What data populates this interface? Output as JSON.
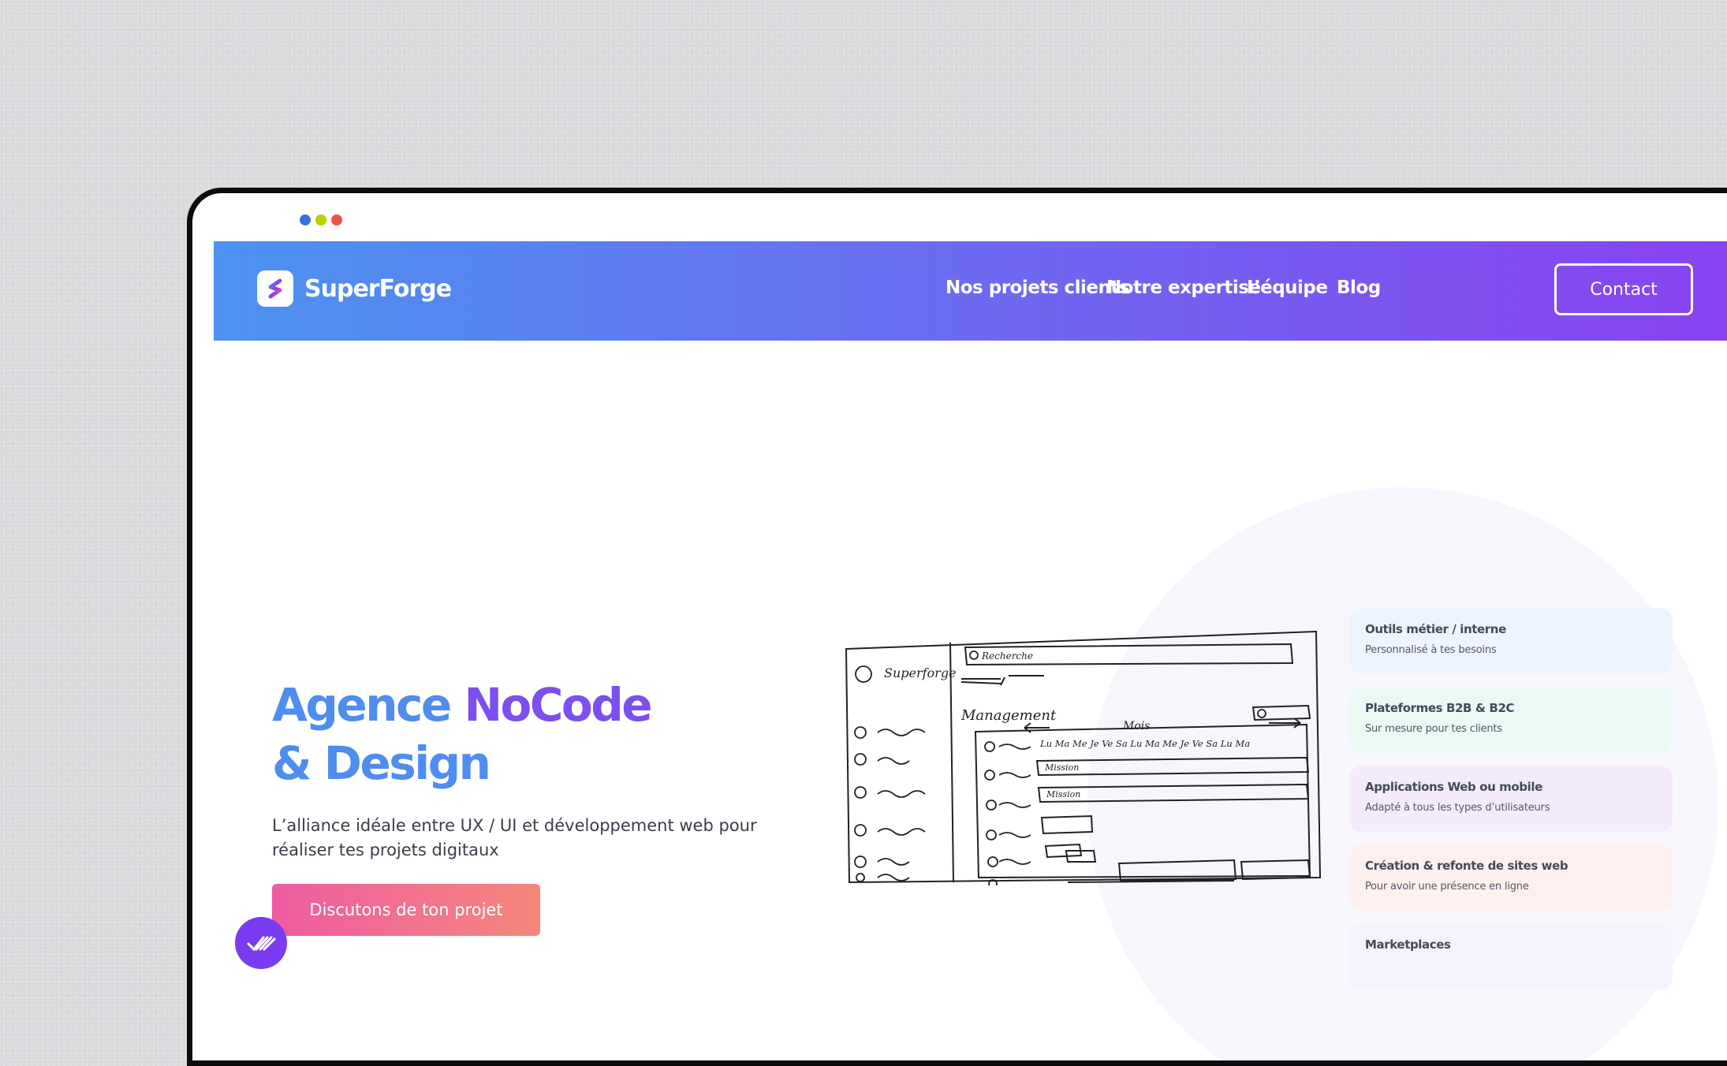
{
  "brand": {
    "name": "SuperForge"
  },
  "nav": {
    "links": [
      "Nos projets clients",
      "Notre expertise",
      "L’équipe",
      "Blog"
    ],
    "contact": "Contact"
  },
  "hero": {
    "title_part1": "Agence ",
    "title_part2": "NoCode",
    "title_line2": "& Design",
    "subtitle": "L’alliance idéale entre UX / UI et développement web pour réaliser tes projets digitaux",
    "cta": "Discutons de ton projet"
  },
  "window_dots": [
    "#3a70e0",
    "#b8d400",
    "#f0504a"
  ],
  "sketch_text": {
    "brand": "Superforge",
    "search": "Recherche",
    "section": "Management",
    "period": "Mois",
    "days": "Lu Ma Me Je Ve Sa Lu Ma Me Je Ve Sa Lu Ma",
    "mission": "Mission",
    "mission2": "Mission"
  },
  "services": [
    {
      "title": "Outils métier / interne",
      "desc": "Personnalisé à tes besoins",
      "bg": "#eef4fd"
    },
    {
      "title": "Plateformes B2B & B2C",
      "desc": "Sur mesure pour tes clients",
      "bg": "#e9f9f4"
    },
    {
      "title": "Applications Web ou mobile",
      "desc": "Adapté à tous les types d’utilisateurs",
      "bg": "#f3ebfc"
    },
    {
      "title": "Création & refonte de sites web",
      "desc": "Pour avoir une présence en ligne",
      "bg": "#fdf0ee"
    },
    {
      "title": "Marketplaces",
      "desc": "",
      "bg": "#f4f2fc"
    }
  ]
}
